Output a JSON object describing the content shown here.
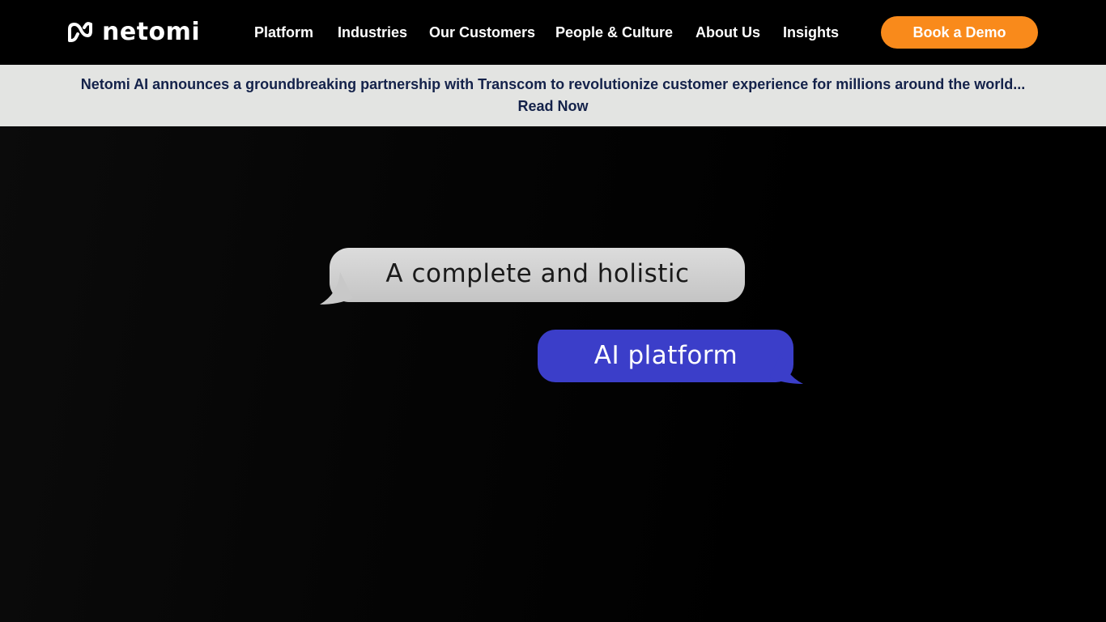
{
  "brand": {
    "name": "netomi",
    "accent_color": "#f98a1b",
    "icon": "netomi-logo-icon"
  },
  "nav": {
    "items": [
      {
        "label": "Platform"
      },
      {
        "label": "Industries"
      },
      {
        "label": "Our Customers"
      },
      {
        "label": "People & Culture"
      },
      {
        "label": "About Us"
      },
      {
        "label": "Insights"
      }
    ],
    "cta_label": "Book a Demo"
  },
  "announcement": {
    "text": "Netomi AI announces a groundbreaking partnership with Transcom to revolutionize customer experience for millions around the world... Read Now",
    "background": "#e3e4e2",
    "text_color": "#14224a"
  },
  "hero": {
    "bubble_gray_text": "A complete and holistic",
    "bubble_blue_text": "AI platform",
    "bubble_gray_color": "#cfcfcf",
    "bubble_blue_color": "#3b3ec9"
  }
}
